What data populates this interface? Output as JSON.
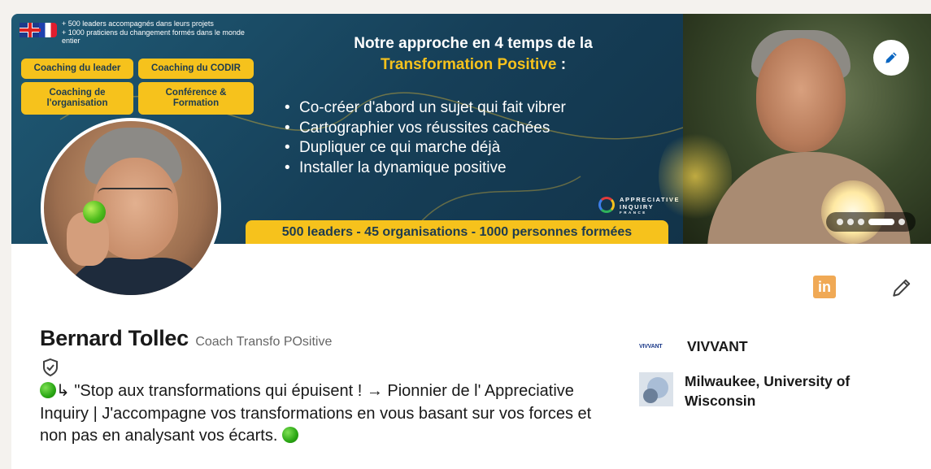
{
  "banner": {
    "claims": [
      "+ 500 leaders accompagnés dans leurs projets",
      "+ 1000 praticiens du changement formés dans le monde entier"
    ],
    "chips": [
      "Coaching du leader",
      "Coaching du CODIR",
      "Coaching de l'organisation",
      "Conférence & Formation"
    ],
    "title_line1": "Notre approche en 4 temps de la",
    "title_highlight": "Transformation Positive",
    "title_suffix": " :",
    "bullets": [
      "Co-créer d'abord un sujet qui fait vibrer",
      "Cartographier vos réussites cachées",
      "Dupliquer ce qui marche déjà",
      "Installer la dynamique positive"
    ],
    "logo_text": [
      "APPRECIATIVE",
      "INQUIRY",
      "FRANCE"
    ],
    "strip": "500 leaders - 45 organisations - 1000 personnes formées",
    "accent_color": "#f6c21c",
    "background_color": "#1f5a75"
  },
  "profile": {
    "name": "Bernard Tollec",
    "pronoun": "Coach Transfo POsitive",
    "headline_arrow": "↳ \"Stop aux transformations qui épuisent ! → Pionnier de l' Appreciative Inquiry | J'accompagne vos transformations en vous basant sur vos forces et non pas en analysant vos écarts.",
    "linkedin_label": "in"
  },
  "orgs": [
    {
      "logo_text": "VIVVANT",
      "name": "VIVVANT"
    },
    {
      "name": "Milwaukee, University of Wisconsin"
    }
  ],
  "icons": [
    "pencil-icon",
    "verified-shield-icon",
    "linkedin-icon",
    "pencil-outline-icon",
    "green-circle-emoji-icon"
  ]
}
